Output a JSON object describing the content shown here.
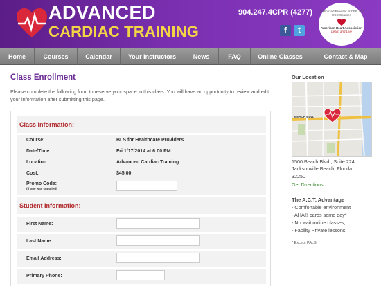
{
  "brand": {
    "line1": "ADVANCED",
    "line2": "CARDIAC TRAINING",
    "phone": "904.247.4CPR (4277)",
    "facebook_glyph": "f",
    "twitter_glyph": "t",
    "aha": {
      "top_text": "Authorized Provider of CPR and ECC Courses",
      "name": "American Heart Association",
      "tagline": "Learn and Live"
    },
    "colors": {
      "purple": "#7a2fb0",
      "yellow": "#f3d447",
      "heart": "#d9283c"
    }
  },
  "nav": {
    "items": [
      {
        "label": "Home"
      },
      {
        "label": "Courses"
      },
      {
        "label": "Calendar"
      },
      {
        "label": "Your Instructors"
      },
      {
        "label": "News"
      },
      {
        "label": "FAQ"
      },
      {
        "label": "Online Classes"
      },
      {
        "label": "Contact & Map"
      }
    ]
  },
  "main": {
    "title": "Class Enrollment",
    "intro": "Please complete the following form to reserve your space in this class. You will have an opportunity to review and edit your information after submitting this page.",
    "class_info": {
      "header": "Class Information:",
      "rows": [
        {
          "label": "Course:",
          "value": "BLS for Healthcare Providers"
        },
        {
          "label": "Date/Time:",
          "value": "Fri 1/17/2014 at 6:00 PM"
        },
        {
          "label": "Location:",
          "value": "Advanced Cardiac Training"
        },
        {
          "label": "Cost:",
          "value": "$45.00"
        }
      ],
      "promo_label": "Promo Code:",
      "promo_sub": "(if one was supplied)",
      "promo_value": ""
    },
    "student_info": {
      "header": "Student Information:",
      "fields": [
        {
          "label": "First Name:",
          "value": ""
        },
        {
          "label": "Last Name:",
          "value": ""
        },
        {
          "label": "Email Address:",
          "value": ""
        },
        {
          "label": "Primary Phone:",
          "value": ""
        }
      ]
    }
  },
  "sidebar": {
    "location_title": "Our Location",
    "map_label": "BEACH BLVD",
    "address_line1": "1500 Beach Blvd., Suite 224",
    "address_line2": "Jacksonville Beach, Florida",
    "address_line3": "32250",
    "directions_link": "Get Directions",
    "advantage_title": "The A.C.T. Advantage",
    "advantages": [
      "- Comfortable environment",
      "- AHA® cards same day*",
      "- No wait online classes,",
      "- Facility Private lessons"
    ],
    "note": "* Except PALS"
  }
}
